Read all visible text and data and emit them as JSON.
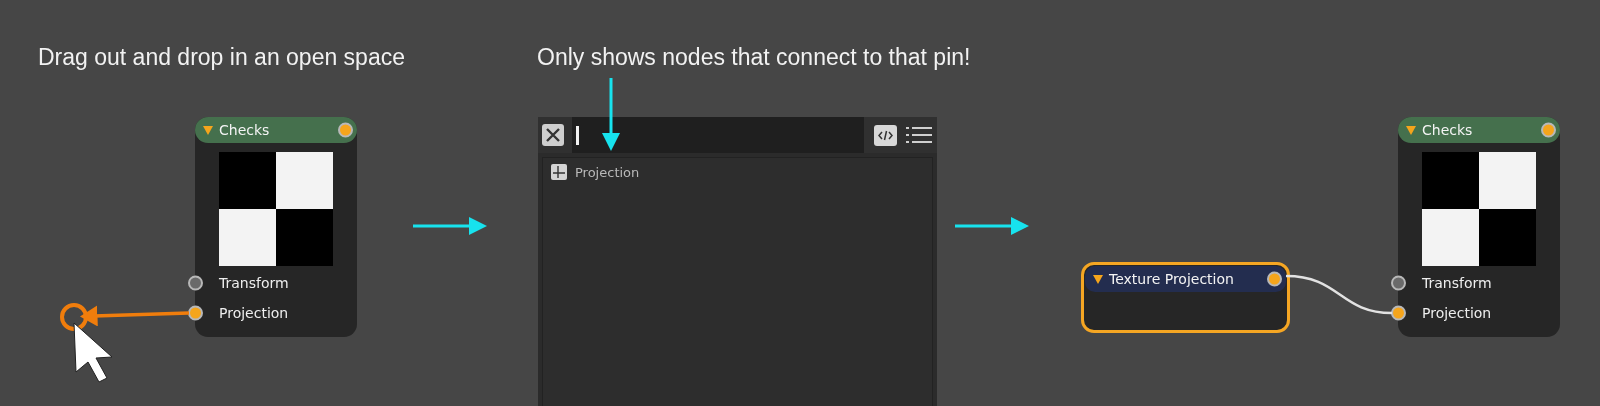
{
  "captions": [
    {
      "text": "Drag out and drop in an open space"
    },
    {
      "text": "Only shows nodes that connect to that pin!"
    }
  ],
  "source_node": {
    "title": "Checks",
    "kind": "pattern",
    "expanded": true,
    "selected": false,
    "output_connected": true,
    "inputs": [
      {
        "label": "Transform",
        "connected": false
      },
      {
        "label": "Projection",
        "connected": true
      }
    ]
  },
  "search_popup": {
    "results": [
      {
        "label": "Projection"
      }
    ]
  },
  "new_node": {
    "title": "Texture Projection",
    "kind": "projection",
    "expanded": true,
    "selected": true,
    "output_connected": true
  },
  "result_node": {
    "title": "Checks",
    "kind": "pattern",
    "expanded": true,
    "selected": false,
    "output_connected": true,
    "inputs": [
      {
        "label": "Transform",
        "connected": false
      },
      {
        "label": "Projection",
        "connected": true
      }
    ]
  }
}
